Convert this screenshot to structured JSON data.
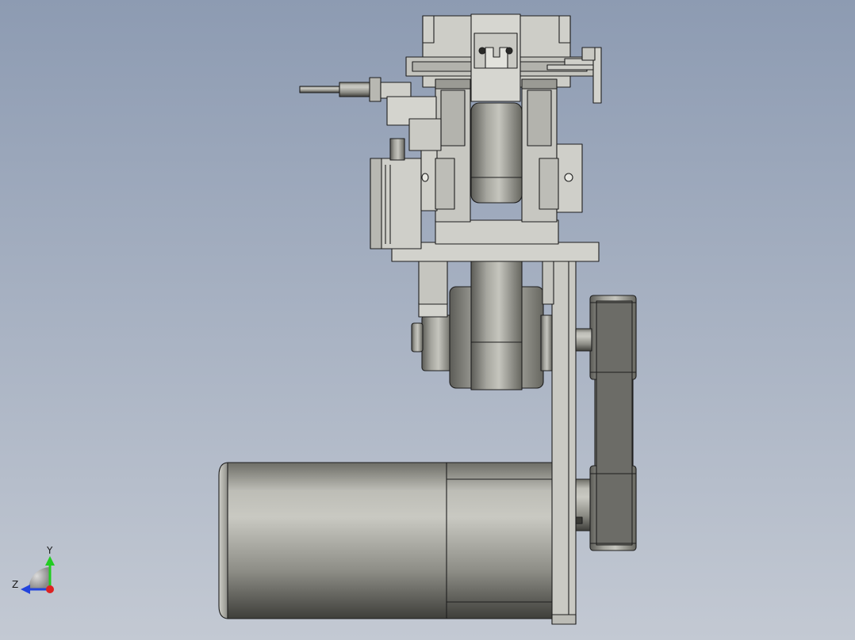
{
  "viewport": {
    "background_top": "#8d9bb2",
    "background_bottom": "#c3c9d3"
  },
  "model": {
    "parts": [
      "motor",
      "drive-belt",
      "vertical-plate",
      "main-roller",
      "lower-pulley",
      "upper-assembly",
      "clamp-block",
      "spring-rod",
      "sensor-bracket"
    ]
  },
  "triad": {
    "y_label": "Y",
    "z_label": "Z",
    "y_color": "#22cc22",
    "z_color": "#2244dd",
    "x_color": "#dd2222"
  }
}
